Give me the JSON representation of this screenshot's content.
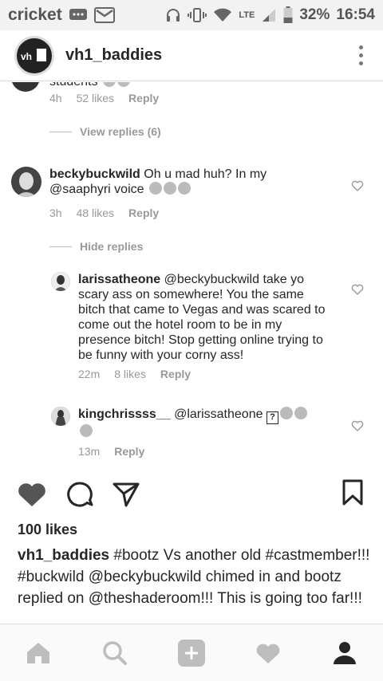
{
  "status_bar": {
    "carrier": "cricket",
    "network": "LTE",
    "battery": "32%",
    "time": "16:54"
  },
  "header": {
    "username": "vh1_baddies"
  },
  "comments": [
    {
      "id": "c0",
      "text_partial": "students",
      "time": "4h",
      "likes": "52 likes",
      "reply": "Reply",
      "replies_toggle": "View replies (6)"
    },
    {
      "id": "c1",
      "username": "beckybuckwild",
      "text": "Oh u mad huh? In my @saaphyri voice",
      "time": "3h",
      "likes": "48 likes",
      "reply": "Reply",
      "replies_toggle": "Hide replies"
    },
    {
      "id": "r1",
      "username": "larissatheone",
      "text": "@beckybuckwild take yo scary ass on somewhere! You the same bitch that came to Vegas and was scared to come out the hotel room to be in my presence bitch! Stop getting online trying to be funny with your corny ass!",
      "time": "22m",
      "likes": "8 likes",
      "reply": "Reply"
    },
    {
      "id": "r2",
      "username": "kingchrissss__",
      "text": "@larissatheone",
      "time": "13m",
      "reply": "Reply"
    }
  ],
  "post": {
    "likes": "100 likes",
    "caption_user": "vh1_baddies",
    "caption_text": "#bootz Vs another old #castmember!!! #buckwild @beckybuckwild chimed in and bootz replied on @theshaderoom!!! This is going too far!!!"
  },
  "icons": {
    "like": "heart-icon",
    "comment": "comment-icon",
    "share": "send-icon",
    "save": "bookmark-icon"
  },
  "colors": {
    "text": "#262626",
    "muted": "#999999",
    "divider": "#dbdbdb"
  }
}
